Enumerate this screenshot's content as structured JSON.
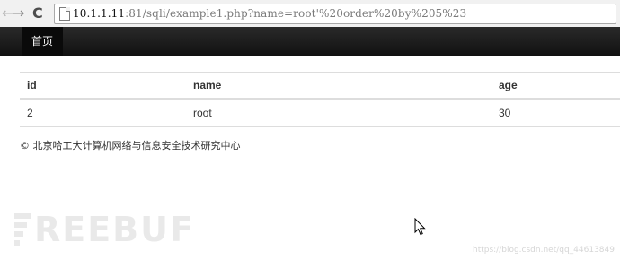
{
  "browser": {
    "nav_back": "←",
    "nav_forward": "→",
    "nav_reload": "C",
    "url_host": "10.1.1.11",
    "url_rest": ":81/sqli/example1.php?name=root'%20order%20by%205%23"
  },
  "navbar": {
    "home_label": "首页"
  },
  "table": {
    "headers": [
      "id",
      "name",
      "age"
    ],
    "rows": [
      [
        "2",
        "root",
        "30"
      ]
    ]
  },
  "footer": {
    "text": "© 北京哈工大计算机网络与信息安全技术研究中心"
  },
  "watermark": {
    "text": "REEBUF",
    "source": "https://blog.csdn.net/qq_44613849"
  },
  "colors": {
    "navbar_bg": "#1a1a1a",
    "table_border": "#dddddd",
    "watermark": "#e9e9e9"
  }
}
